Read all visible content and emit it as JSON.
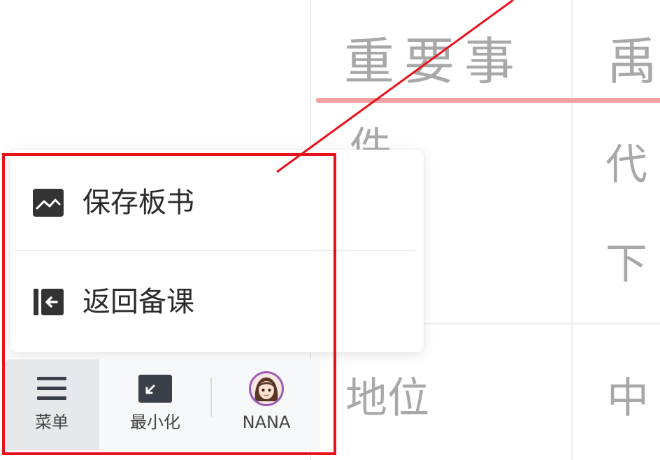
{
  "board": {
    "heading_left": "重要事",
    "heading_right": "禹",
    "row1_right_line1": "代",
    "row1_right_line2": "下",
    "row1_left_partial": "件",
    "row2_left": "地位",
    "row2_right": "中"
  },
  "menu": {
    "items": [
      {
        "label": "保存板书",
        "icon": "image-icon"
      },
      {
        "label": "返回备课",
        "icon": "return-icon"
      }
    ]
  },
  "toolbar": {
    "menu_label": "菜单",
    "minimize_label": "最小化",
    "user_label": "NANA"
  },
  "colors": {
    "annotation_red": "#e8121b",
    "underline_pink": "#f4a1a1",
    "board_text_gray": "#a8a8a8",
    "avatar_ring_purple": "#9b5ab7"
  }
}
